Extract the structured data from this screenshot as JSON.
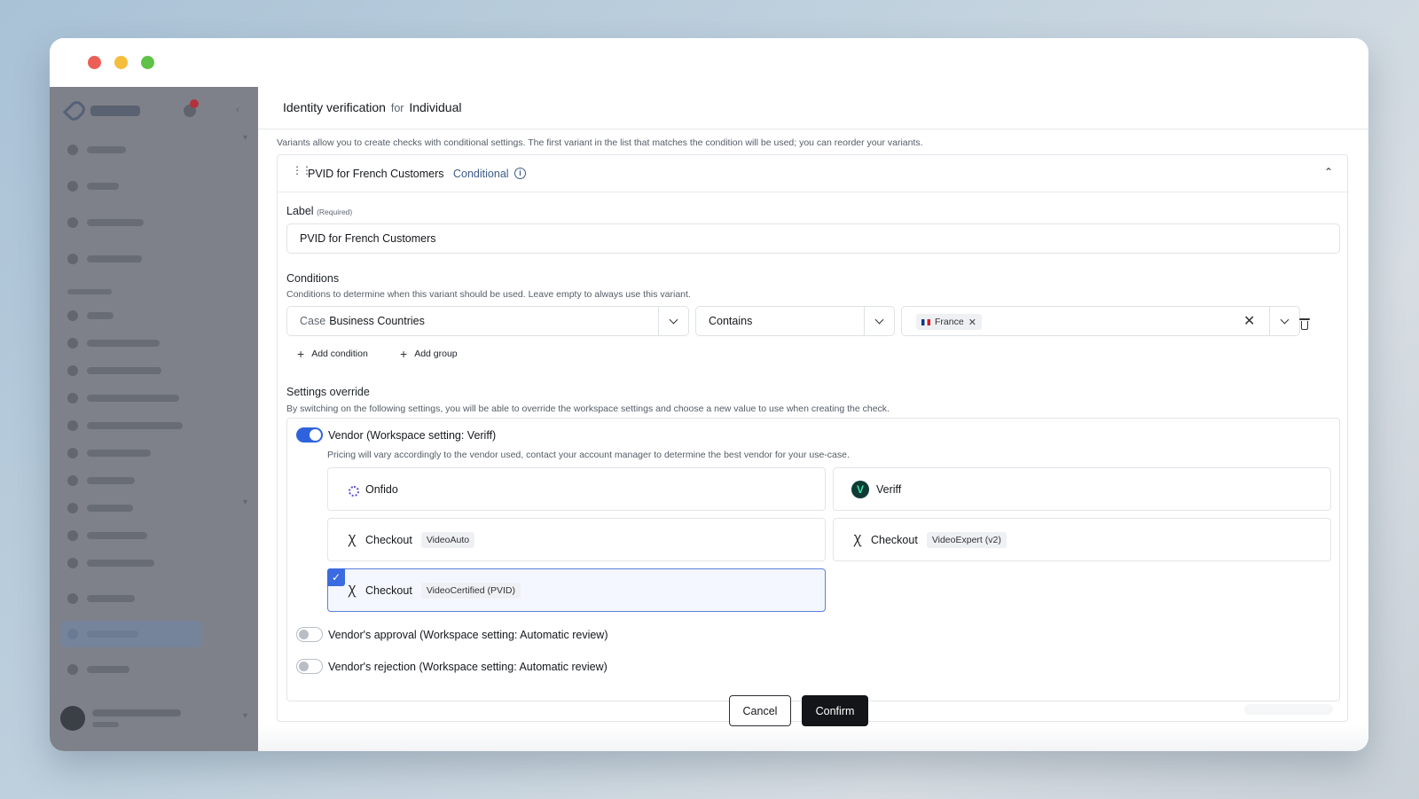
{
  "modal": {
    "title_main": "Identity verification",
    "title_for": "for",
    "title_entity": "Individual",
    "variants_hint": "Variants allow you to create checks with conditional settings. The first variant in the list that matches the condition will be used; you can reorder your variants."
  },
  "variant": {
    "name": "PVID for French Customers",
    "tag": "Conditional",
    "info_glyph": "i",
    "label_title": "Label",
    "label_required": "(Required)",
    "label_value": "PVID for French Customers"
  },
  "conditions": {
    "title": "Conditions",
    "hint": "Conditions to determine when this variant should be used. Leave empty to always use this variant.",
    "field_prefix": "Case",
    "field_value": "Business Countries",
    "operator": "Contains",
    "chip_value": "France",
    "add_condition": "Add condition",
    "add_group": "Add group"
  },
  "settings": {
    "title": "Settings override",
    "hint": "By switching on the following settings, you will be able to override the workspace settings and choose a new value to use when creating the check.",
    "vendor_toggle_label": "Vendor (Workspace setting: Veriff)",
    "vendor_hint": "Pricing will vary accordingly to the vendor used, contact your account manager to determine the best vendor for your use-case.",
    "vendors": [
      {
        "name": "Onfido",
        "badge": ""
      },
      {
        "name": "Veriff",
        "badge": ""
      },
      {
        "name": "Checkout",
        "badge": "VideoAuto"
      },
      {
        "name": "Checkout",
        "badge": "VideoExpert (v2)"
      },
      {
        "name": "Checkout",
        "badge": "VideoCertified (PVID)"
      }
    ],
    "approval_toggle_label": "Vendor's approval (Workspace setting: Automatic review)",
    "rejection_toggle_label": "Vendor's rejection (Workspace setting: Automatic review)"
  },
  "footer": {
    "cancel": "Cancel",
    "confirm": "Confirm"
  },
  "colors": {
    "accent": "#2f63dd",
    "selected_border": "#5b7fe0",
    "confirm_bg": "#141518"
  }
}
